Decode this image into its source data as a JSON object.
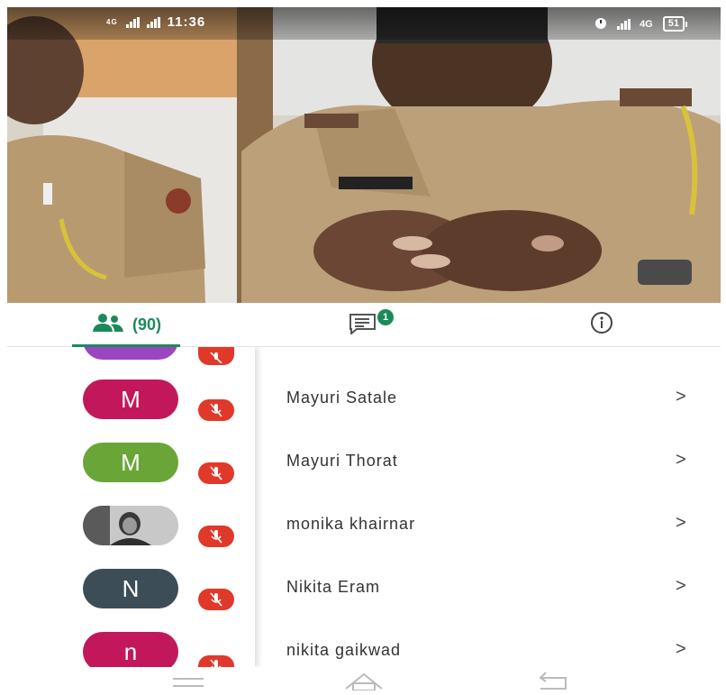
{
  "status_bar": {
    "time": "11:36",
    "network_left": "4G",
    "network_right": "4G",
    "battery": "51"
  },
  "tabs": {
    "participants_count": "(90)",
    "chat_badge": "1"
  },
  "participants": [
    {
      "initial": "M",
      "name": "Mayuri Satale",
      "color": "#c2185b"
    },
    {
      "initial": "M",
      "name": "Mayuri Thorat",
      "color": "#6aa637"
    },
    {
      "initial": "",
      "name": "monika khairnar",
      "color": "#bdbdbd",
      "photo": true
    },
    {
      "initial": "N",
      "name": "Nikita Eram",
      "color": "#3d4d57"
    },
    {
      "initial": "n",
      "name": "nikita gaikwad",
      "color": "#c2185b"
    }
  ],
  "chevron": ">",
  "colors": {
    "accent": "#1b8a5a",
    "mic_off": "#e0392a"
  }
}
